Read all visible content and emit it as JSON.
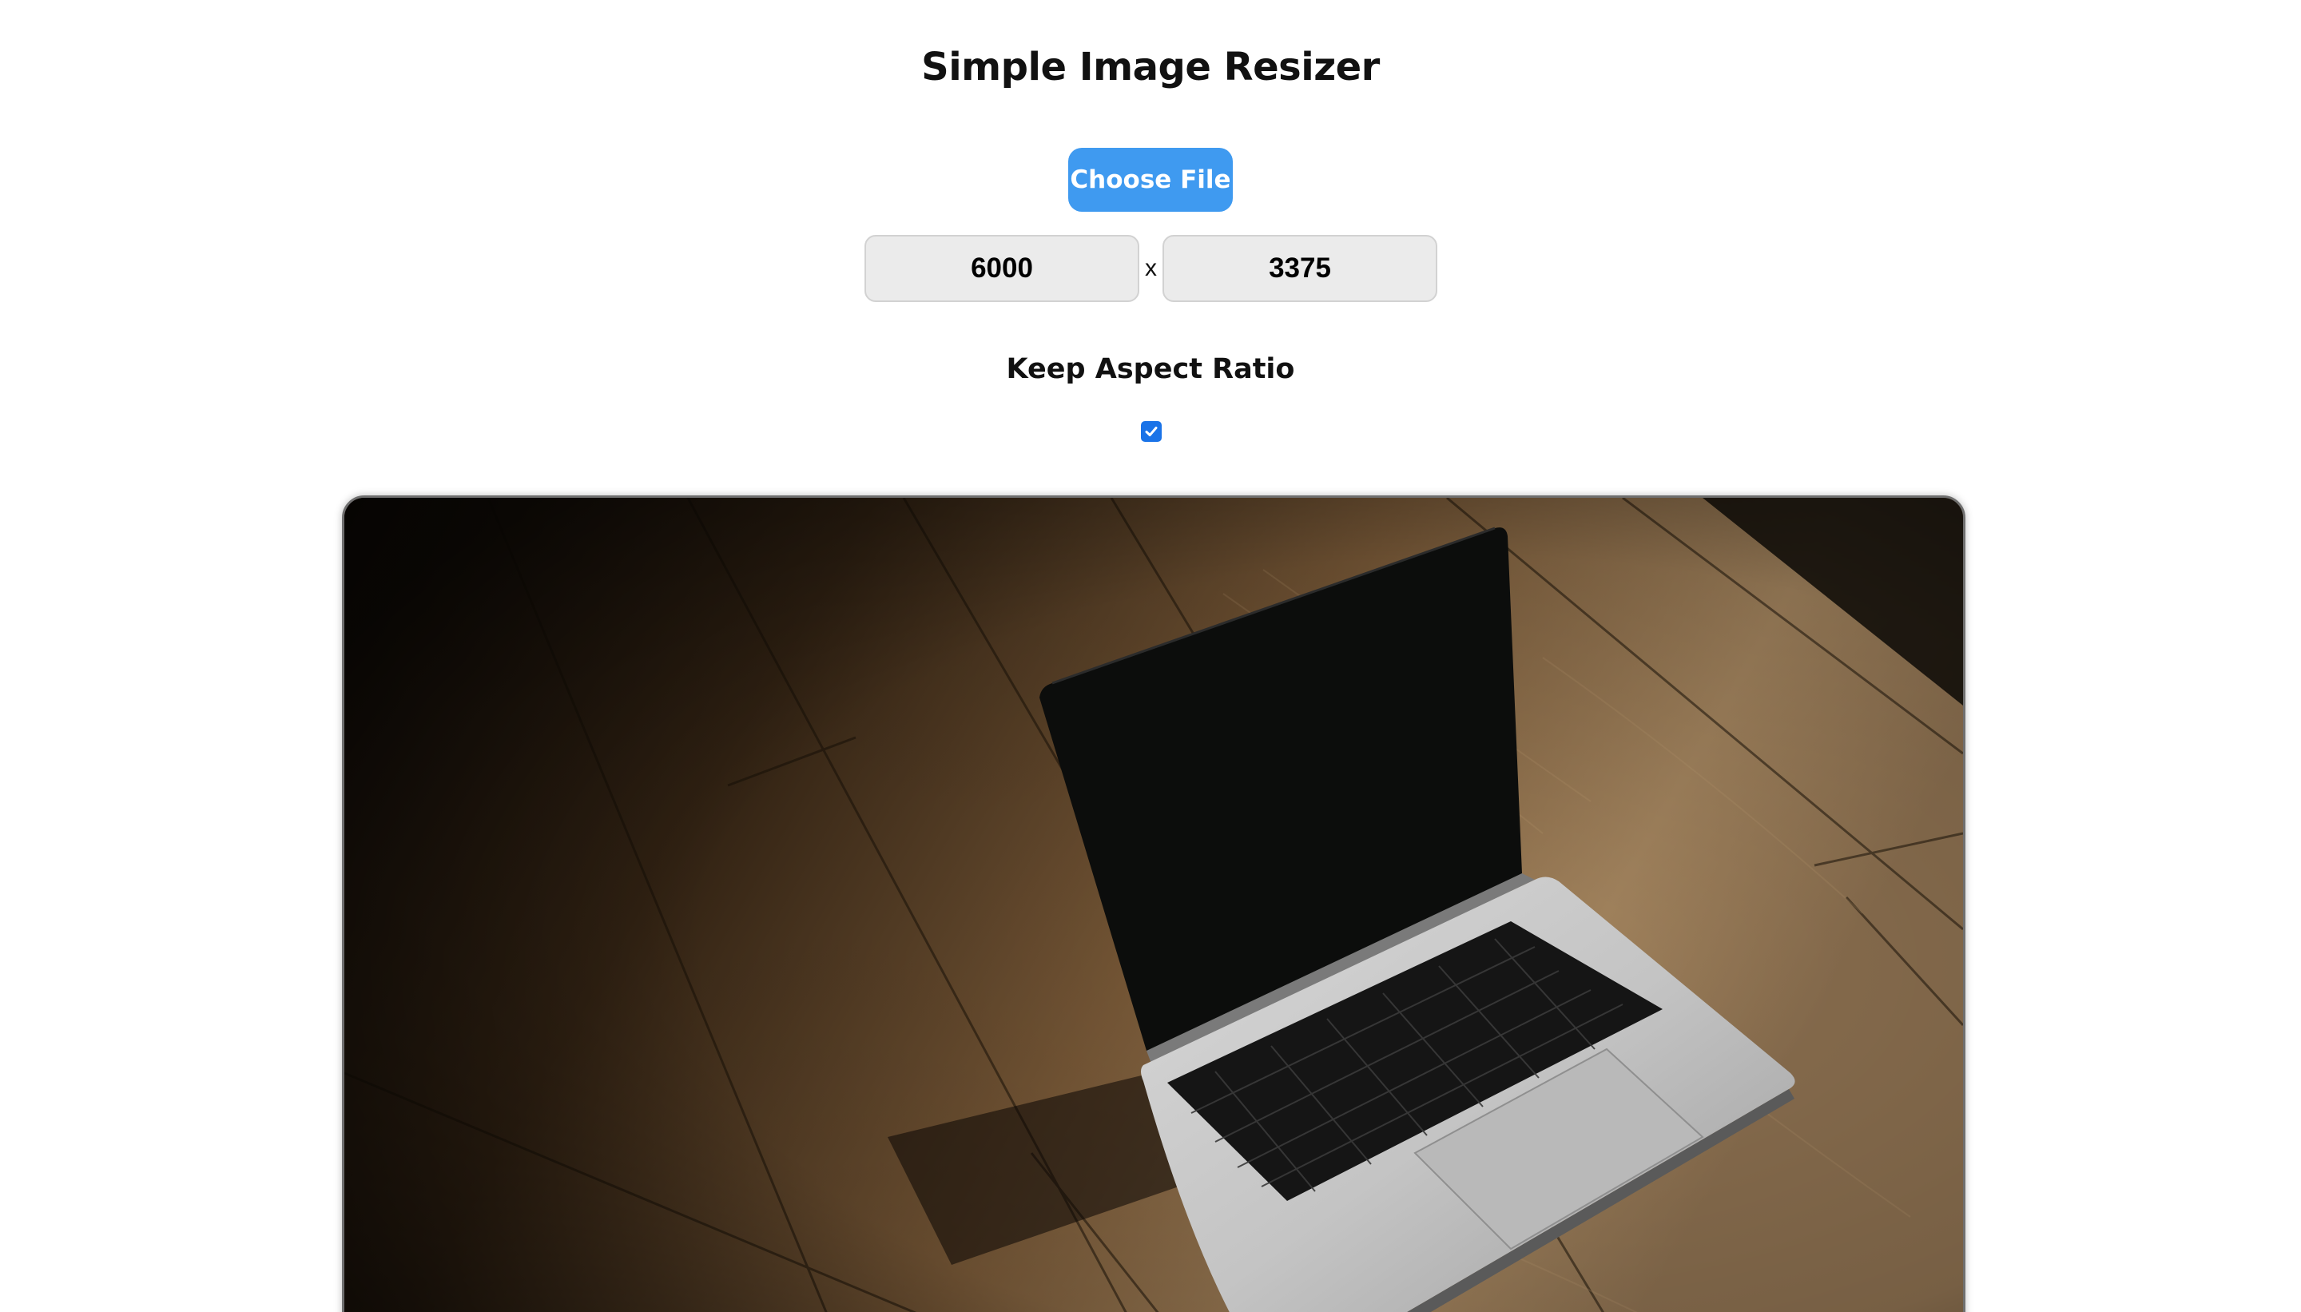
{
  "app": {
    "title": "Simple Image Resizer"
  },
  "controls": {
    "choose_file_label": "Choose File",
    "width_value": "6000",
    "height_value": "3375",
    "separator": "x",
    "keep_aspect_label": "Keep Aspect Ratio",
    "keep_aspect_checked": true
  },
  "preview": {
    "image_subject": "laptop on wooden floor"
  },
  "colors": {
    "accent": "#3f9af0",
    "checkbox": "#1a73e8",
    "input_background": "#ebebeb"
  }
}
